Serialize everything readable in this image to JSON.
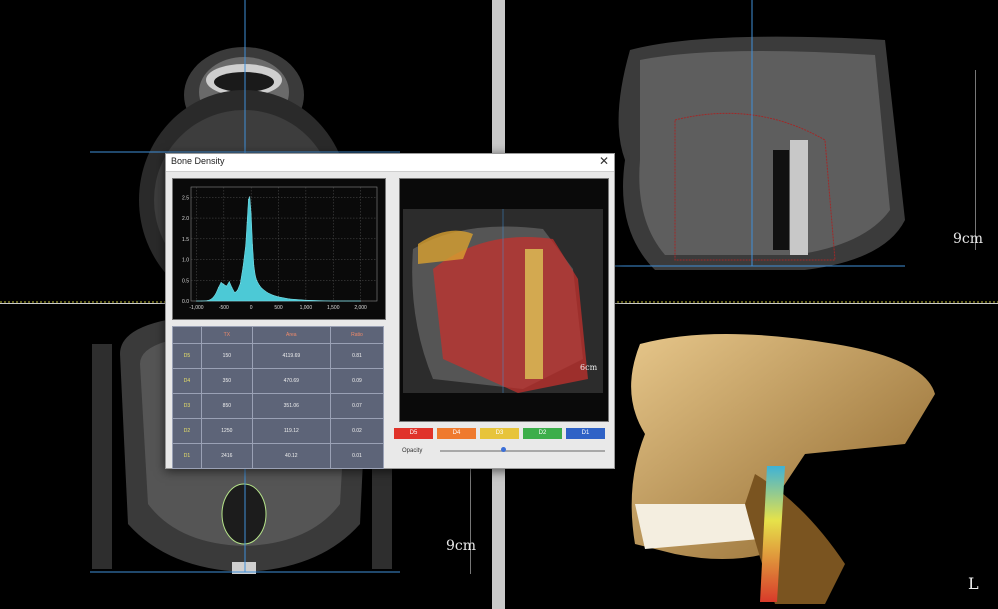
{
  "dialog": {
    "title": "Bone Density",
    "close_glyph": "✕",
    "table": {
      "headers": [
        "",
        "TX",
        "Area",
        "Ratio"
      ],
      "rows": [
        {
          "label": "D5",
          "tx": "150",
          "area": "4119.69",
          "ratio": "0.81"
        },
        {
          "label": "D4",
          "tx": "350",
          "area": "470.69",
          "ratio": "0.09"
        },
        {
          "label": "D3",
          "tx": "850",
          "area": "351.06",
          "ratio": "0.07"
        },
        {
          "label": "D2",
          "tx": "1250",
          "area": "119.12",
          "ratio": "0.02"
        },
        {
          "label": "D1",
          "tx": "2416",
          "area": "40.12",
          "ratio": "0.01"
        }
      ]
    },
    "legend": [
      {
        "label": "D5",
        "color": "#e0332a"
      },
      {
        "label": "D4",
        "color": "#ef7a2e"
      },
      {
        "label": "D3",
        "color": "#e7c43a"
      },
      {
        "label": "D2",
        "color": "#3cae4a"
      },
      {
        "label": "D1",
        "color": "#2f62c6"
      }
    ],
    "opacity_label": "Opacity",
    "opacity_value": 0.38,
    "preview_scale": "6cm"
  },
  "chart_data": {
    "type": "area",
    "x": [
      -1000,
      -900,
      -800,
      -750,
      -700,
      -650,
      -600,
      -550,
      -500,
      -450,
      -400,
      -350,
      -300,
      -250,
      -200,
      -150,
      -100,
      -75,
      -50,
      -25,
      0,
      25,
      50,
      75,
      100,
      150,
      200,
      300,
      400,
      500,
      700,
      1000,
      1500,
      2000
    ],
    "values": [
      0.0,
      0.0,
      0.01,
      0.03,
      0.08,
      0.17,
      0.32,
      0.45,
      0.4,
      0.36,
      0.47,
      0.32,
      0.2,
      0.26,
      0.42,
      0.82,
      1.35,
      1.9,
      2.45,
      2.52,
      2.1,
      1.35,
      0.85,
      0.62,
      0.5,
      0.38,
      0.3,
      0.2,
      0.14,
      0.1,
      0.05,
      0.02,
      0.0,
      0.0
    ],
    "x_ticks": [
      "-1,000",
      "-500",
      "0",
      "500",
      "1,000",
      "1,500",
      "2,000"
    ],
    "x_tick_values": [
      -1000,
      -500,
      0,
      500,
      1000,
      1500,
      2000
    ],
    "y_ticks": [
      "0.0",
      "0.5",
      "1.0",
      "1.5",
      "2.0",
      "2.5"
    ],
    "y_tick_values": [
      0,
      0.5,
      1,
      1.5,
      2,
      2.5
    ],
    "xlim": [
      -1100,
      2300
    ],
    "ylim": [
      0,
      2.75
    ],
    "grid": true,
    "fill_color": "#4cc9d6"
  },
  "viewports": {
    "axial_scale": "9cm",
    "sagittal_scale": "9cm",
    "render_orientation": "L"
  },
  "toolbar_icons": [
    "skull-front-icon",
    "skull-side-icon",
    "skull-back-icon",
    "skull-top-icon",
    "skull-bottom-icon",
    "skull-reset-icon"
  ],
  "colors": {
    "crosshair": "#3f8fd8",
    "divider_dashed": "#c9c43a"
  }
}
